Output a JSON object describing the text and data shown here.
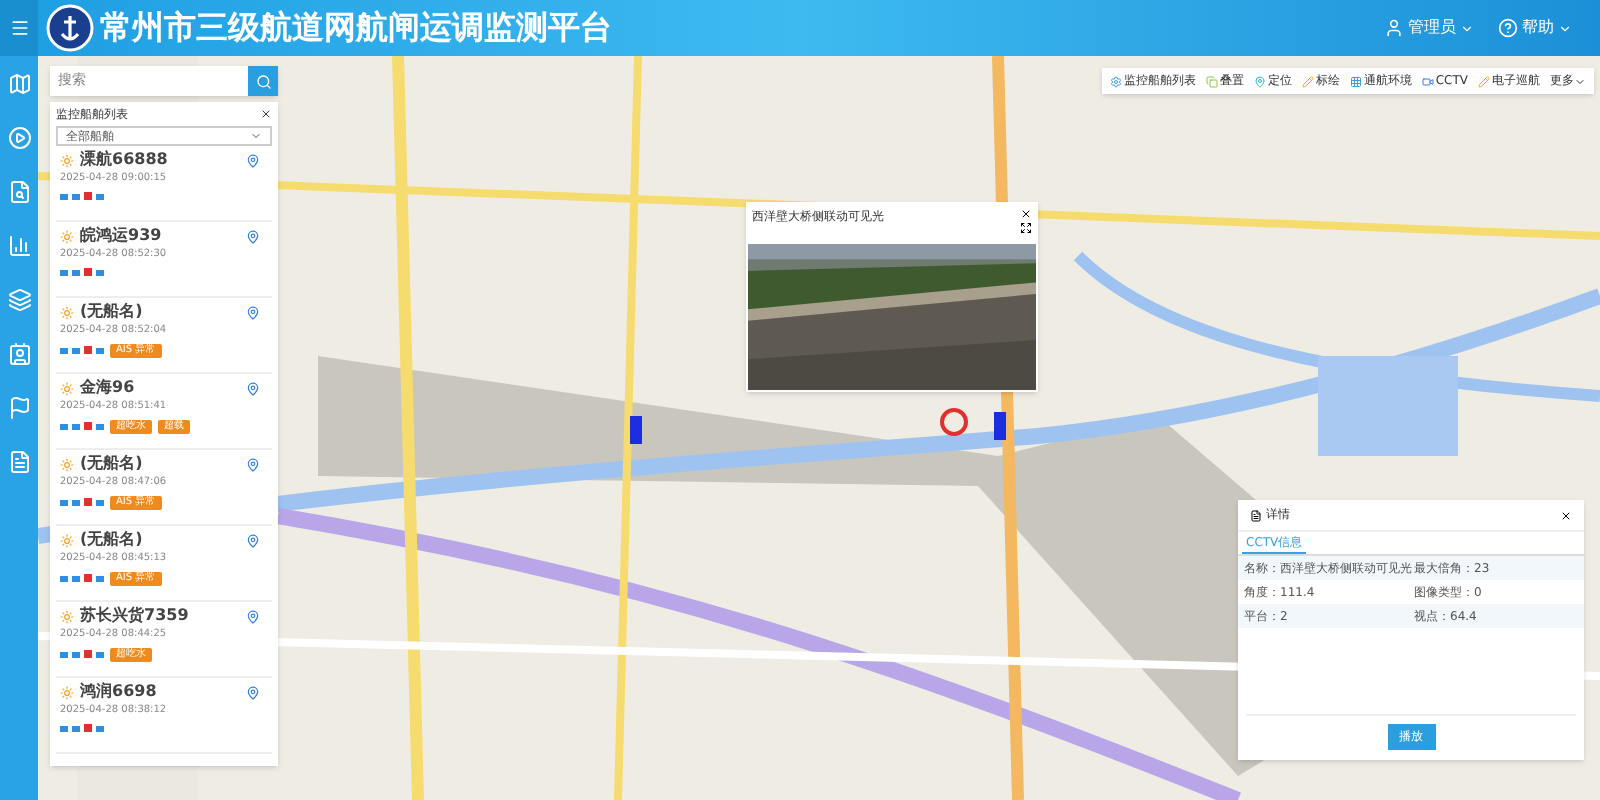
{
  "header": {
    "title": "常州市三级航道网航闸运调监测平台",
    "user": "管理员",
    "help": "帮助"
  },
  "rail": {
    "items": [
      {
        "kind": "map"
      },
      {
        "kind": "play"
      },
      {
        "kind": "search"
      },
      {
        "kind": "chart"
      },
      {
        "kind": "layers"
      },
      {
        "kind": "person"
      },
      {
        "kind": "flag"
      },
      {
        "kind": "doc"
      }
    ]
  },
  "search": {
    "placeholder": "搜索"
  },
  "ship_list": {
    "title": "监控船舶列表",
    "filter": "全部船舶",
    "ships": [
      {
        "name": "溧航66888",
        "time": "2025-04-28 09:00:15"
      },
      {
        "name": "皖鸿运939",
        "time": "2025-04-28 08:52:30"
      },
      {
        "name": "(无船名)",
        "time": "2025-04-28 08:52:04",
        "badges": [
          "AIS 异常"
        ]
      },
      {
        "name": "金海96",
        "time": "2025-04-28 08:51:41",
        "badges": [
          "超吃水",
          "超载"
        ]
      },
      {
        "name": "(无船名)",
        "time": "2025-04-28 08:47:06",
        "badges": [
          "AIS 异常"
        ]
      },
      {
        "name": "(无船名)",
        "time": "2025-04-28 08:45:13",
        "badges": [
          "AIS 异常"
        ]
      },
      {
        "name": "苏长兴货7359",
        "time": "2025-04-28 08:44:25",
        "badges": [
          "超吃水"
        ]
      },
      {
        "name": "鸿润6698",
        "time": "2025-04-28 08:38:12"
      }
    ]
  },
  "toolbar": [
    {
      "label": "监控船舶列表",
      "kind": "gear"
    },
    {
      "label": "叠置",
      "kind": "copy"
    },
    {
      "label": "定位",
      "kind": "pin"
    },
    {
      "label": "标绘",
      "kind": "pen"
    },
    {
      "label": "通航环境",
      "kind": "grid"
    },
    {
      "label": "CCTV",
      "kind": "camera"
    },
    {
      "label": "电子巡航",
      "kind": "pen"
    },
    {
      "label": "更多",
      "kind": "more"
    }
  ],
  "video": {
    "title": "西洋壁大桥侧联动可见光"
  },
  "details": {
    "title": "详情",
    "tab": "CCTV信息",
    "rows": [
      [
        "名称：西洋壁大桥侧联动可见光",
        "最大倍角：23"
      ],
      [
        "角度：111.4",
        "图像类型：0"
      ],
      [
        "平台：2",
        "视点：64.4"
      ]
    ],
    "button": "播放"
  }
}
